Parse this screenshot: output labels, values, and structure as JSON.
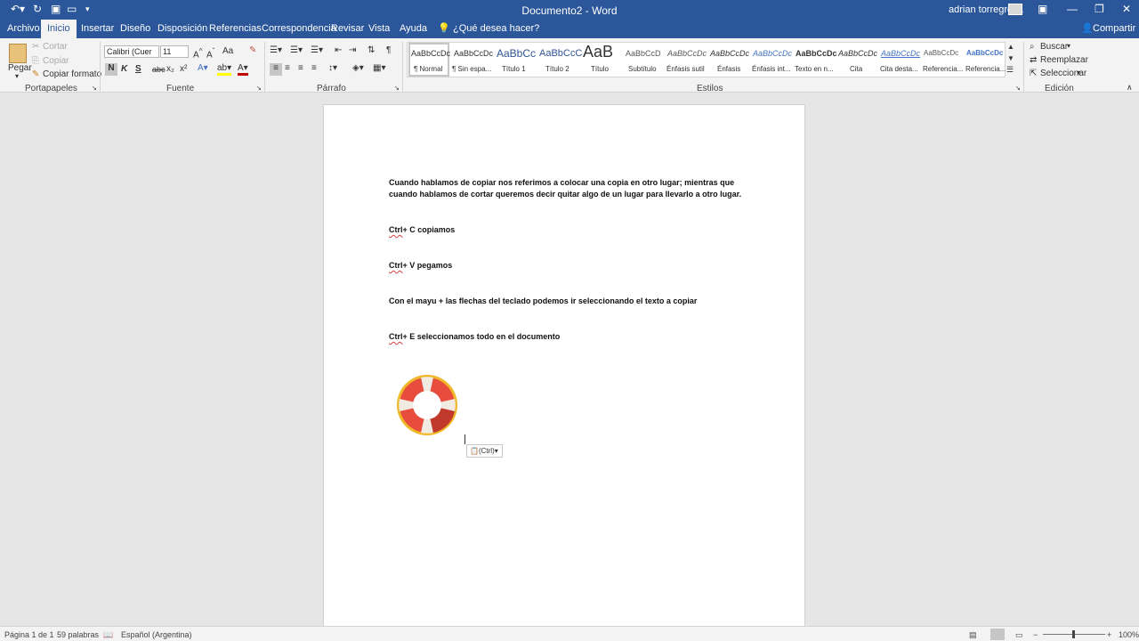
{
  "titlebar": {
    "title": "Documento2 - Word",
    "user": "adrian torregrosa"
  },
  "tabs": [
    "Archivo",
    "Inicio",
    "Insertar",
    "Diseño",
    "Disposición",
    "Referencias",
    "Correspondencia",
    "Revisar",
    "Vista",
    "Ayuda"
  ],
  "tell_me": "¿Qué desea hacer?",
  "share": "Compartir",
  "clipboard": {
    "paste": "Pegar",
    "cut": "Cortar",
    "copy": "Copiar",
    "format_painter": "Copiar formato",
    "label": "Portapapeles"
  },
  "font": {
    "name": "Calibri (Cuer",
    "size": "11",
    "label": "Fuente",
    "bold": "N",
    "italic": "K",
    "underline": "S",
    "strike": "abc",
    "sub": "x₂",
    "sup": "x²",
    "case": "Aa"
  },
  "paragraph": {
    "label": "Párrafo"
  },
  "styles": {
    "label": "Estilos",
    "items": [
      {
        "preview": "AaBbCcDc",
        "name": "¶ Normal"
      },
      {
        "preview": "AaBbCcDc",
        "name": "¶ Sin espa..."
      },
      {
        "preview": "AaBbCc",
        "name": "Título 1"
      },
      {
        "preview": "AaBbCcC",
        "name": "Título 2"
      },
      {
        "preview": "AaB",
        "name": "Título"
      },
      {
        "preview": "AaBbCcD",
        "name": "Subtítulo"
      },
      {
        "preview": "AaBbCcDc",
        "name": "Énfasis sutil"
      },
      {
        "preview": "AaBbCcDc",
        "name": "Énfasis"
      },
      {
        "preview": "AaBbCcDc",
        "name": "Énfasis int..."
      },
      {
        "preview": "AaBbCcDc",
        "name": "Texto en n..."
      },
      {
        "preview": "AaBbCcDc",
        "name": "Cita"
      },
      {
        "preview": "AaBbCcDc",
        "name": "Cita desta..."
      },
      {
        "preview": "AaBbCcDc",
        "name": "Referencia..."
      },
      {
        "preview": "AaBbCcDc",
        "name": "Referencia..."
      }
    ]
  },
  "editing": {
    "find": "Buscar",
    "replace": "Reemplazar",
    "select": "Seleccionar",
    "label": "Edición"
  },
  "document": {
    "p1": "Cuando hablamos de copiar nos referimos a colocar una copia en otro lugar; mientras que\ncuando hablamos de cortar queremos decir quitar algo de un lugar para llevarlo a otro lugar.",
    "ctrl": "Ctrl",
    "p2_rest": "+ C copiamos",
    "p3_rest": "+ V pegamos",
    "p4": "Con el mayu + las flechas del teclado podemos ir seleccionando el texto a copiar",
    "p5_rest": "+ E seleccionamos todo en el documento",
    "paste_options": "(Ctrl)"
  },
  "status": {
    "page": "Página 1 de 1",
    "words": "59 palabras",
    "lang": "Español (Argentina)",
    "zoom": "100%"
  }
}
